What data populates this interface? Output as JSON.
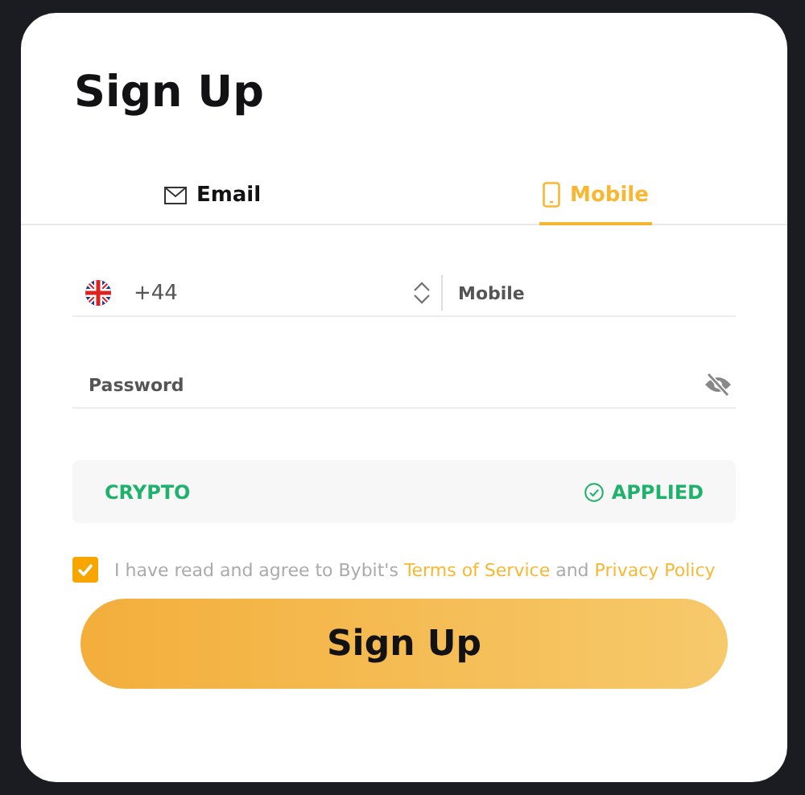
{
  "title": "Sign Up",
  "tabs": [
    {
      "label": "Email",
      "kind": "email",
      "selected": false
    },
    {
      "label": "Mobile",
      "kind": "mobile",
      "selected": true
    }
  ],
  "phone": {
    "country_code": "+44",
    "placeholder": "Mobile"
  },
  "password": {
    "placeholder": "Password",
    "visible": false
  },
  "referral": {
    "code": "CRYPTO",
    "status": "APPLIED"
  },
  "agreement": {
    "checked": true,
    "text_before": "I have read and agree to Bybit's",
    "terms_link": "Terms of Service",
    "conjunction": "and",
    "privacy_link": "Privacy Policy"
  },
  "submit": {
    "label": "Sign Up"
  }
}
